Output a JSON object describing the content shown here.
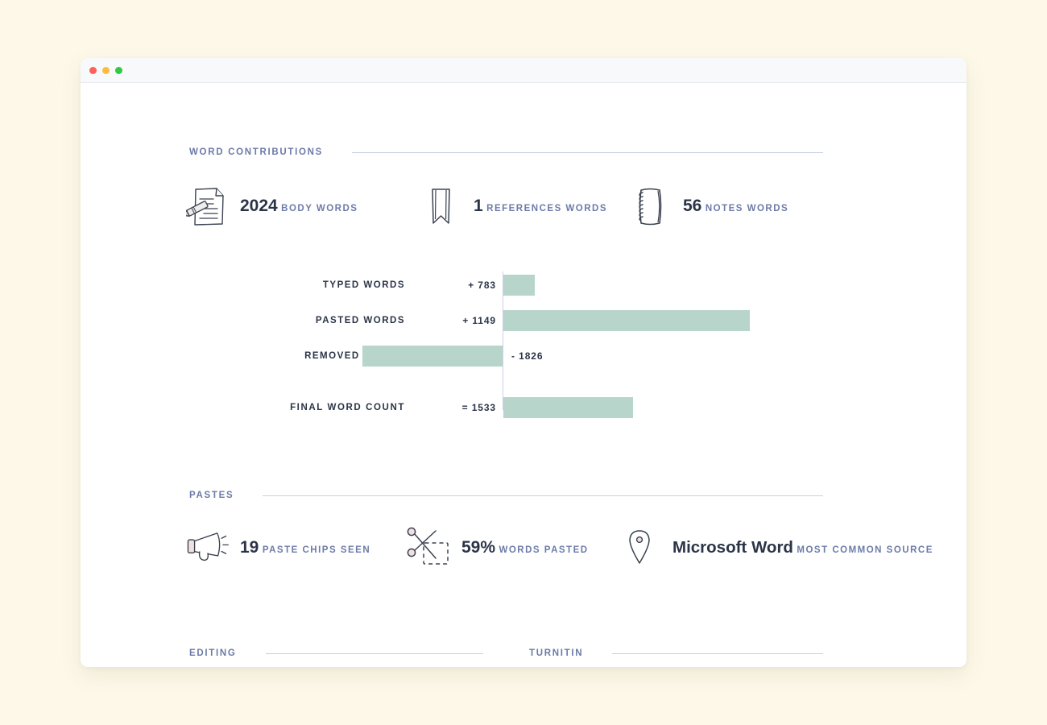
{
  "window": {
    "traffic_lights": [
      "close",
      "minimize",
      "zoom"
    ]
  },
  "sections": {
    "word_contributions": {
      "title": "WORD CONTRIBUTIONS"
    },
    "pastes": {
      "title": "PASTES"
    },
    "editing": {
      "title": "EDITING"
    },
    "turnitin": {
      "title": "TURNITIN"
    }
  },
  "word_stats": [
    {
      "icon": "document-pencil-icon",
      "value": "2024",
      "label": "BODY WORDS"
    },
    {
      "icon": "bookmark-icon",
      "value": "1",
      "label": "REFERENCES WORDS"
    },
    {
      "icon": "notebook-icon",
      "value": "56",
      "label": "NOTES WORDS"
    }
  ],
  "paste_stats": [
    {
      "icon": "megaphone-icon",
      "value": "19",
      "label": "PASTE CHIPS SEEN"
    },
    {
      "icon": "scissors-icon",
      "value": "59%",
      "label": "WORDS PASTED"
    },
    {
      "icon": "map-pin-icon",
      "value": "Microsoft Word",
      "label": "MOST COMMON SOURCE"
    }
  ],
  "chart_data": {
    "type": "bar",
    "orientation": "horizontal",
    "title": "WORD CONTRIBUTIONS",
    "categories": [
      "TYPED WORDS",
      "PASTED WORDS",
      "REMOVED WORDS",
      "FINAL WORD COUNT"
    ],
    "values": [
      783,
      1149,
      -1826,
      1533
    ],
    "value_labels": [
      "+ 783",
      "+ 1149",
      "- 1826",
      "= 1533"
    ],
    "bar_color": "#b7d5cb",
    "axis_color": "#c9d1e4",
    "baseline": 0,
    "xlim": [
      -1826,
      1826
    ],
    "grid": false,
    "legend": false,
    "xlabel": "",
    "ylabel": ""
  },
  "colors": {
    "page_background": "#fdf8e8",
    "window_background": "#ffffff",
    "titlebar": "#f8f9fb",
    "accent_bar": "#b7d5cb",
    "heading_blue": "#6c7ba8",
    "value_dark": "#2b3447",
    "rule": "#c6cfe2"
  }
}
